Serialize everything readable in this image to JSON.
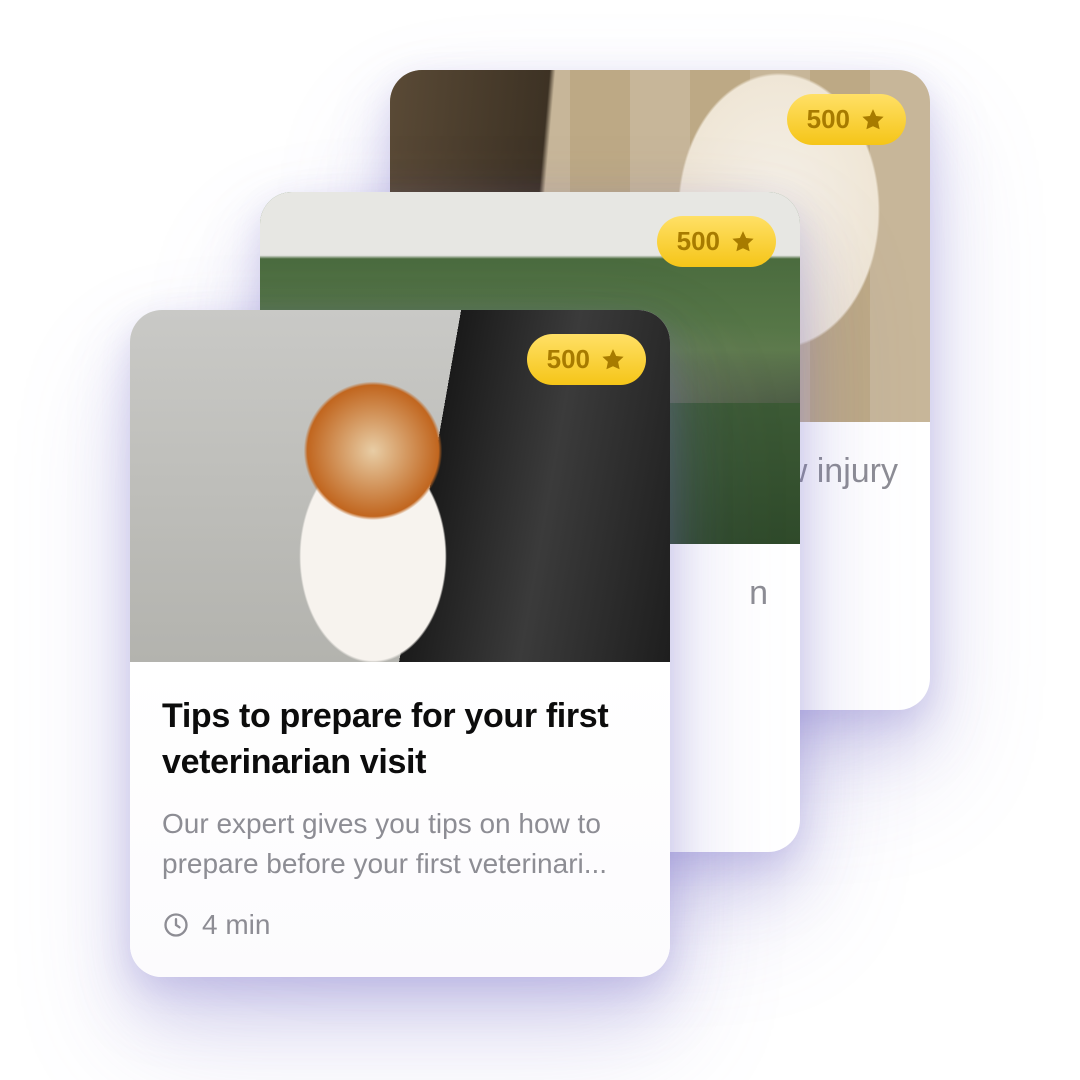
{
  "cards": [
    {
      "badge_value": "500",
      "title": "Tips to prepare for your first veterinarian visit",
      "description": "Our expert gives you tips on how to prepare before your first veterinari...",
      "read_time": "4 min"
    },
    {
      "badge_value": "500",
      "title_fragment_right": "n"
    },
    {
      "badge_value": "500",
      "title_fragment_right": "w injury"
    }
  ]
}
